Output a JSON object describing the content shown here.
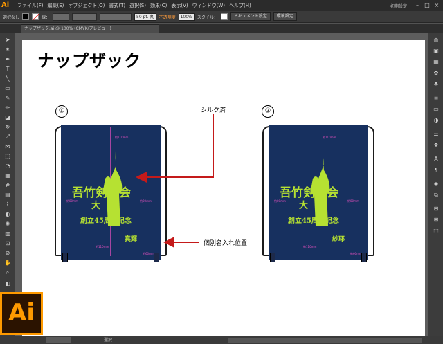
{
  "app": {
    "logo": "Ai",
    "workspace": "初期設定"
  },
  "menu": [
    "ファイル(F)",
    "編集(E)",
    "オブジェクト(O)",
    "書式(T)",
    "選択(S)",
    "効果(C)",
    "表示(V)",
    "ウィンドウ(W)",
    "ヘルプ(H)"
  ],
  "control": {
    "selection": "選択なし",
    "stroke_label": "線：",
    "brush": "50 pt. 丸",
    "opacity_label": "不透明度",
    "opacity_value": "100%",
    "style_label": "スタイル：",
    "doc_settings": "ドキュメント設定",
    "env_settings": "環境設定"
  },
  "doc_tab": "ナップザック.ai @ 100% (CMYK/プレビュー)",
  "artboard": {
    "title": "ナップザック",
    "bag1": {
      "number": "①",
      "club": "吾竹剣友会",
      "place": "大　和",
      "anniv": "創立45周年記念",
      "name": "真輝"
    },
    "bag2": {
      "number": "②",
      "club": "吾竹剣友会",
      "place": "大　和",
      "anniv": "創立45周年記念",
      "name": "紗耶"
    },
    "annot_silk": "シルク済",
    "annot_name": "個別名入れ位置",
    "dims": {
      "top": "約110mm",
      "side_l": "約80mm",
      "side_r": "約80mm",
      "bottom_l": "約110mm",
      "bottom_r": "約60mm"
    }
  },
  "status": {
    "zoom": "100%",
    "tool": "選択"
  },
  "colors": {
    "bag": "#17305f",
    "print": "#b6e132",
    "guides": "#e44fbe",
    "arrow": "#c41a1a",
    "ai_orange": "#ff9a00"
  }
}
